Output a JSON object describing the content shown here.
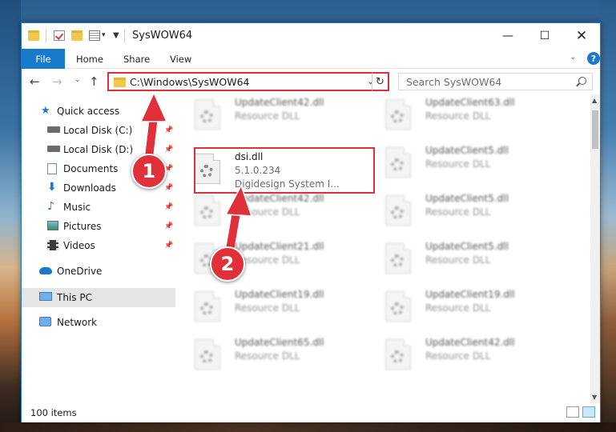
{
  "window": {
    "title": "SysWOW64"
  },
  "ribbon": {
    "tabs": [
      {
        "label": "File"
      },
      {
        "label": "Home"
      },
      {
        "label": "Share"
      },
      {
        "label": "View"
      }
    ],
    "help": "?"
  },
  "navbar": {
    "address_path": "C:\\Windows\\SysWOW64",
    "search_placeholder": "Search SysWOW64"
  },
  "sidebar": {
    "items": [
      {
        "label": "Quick access"
      },
      {
        "label": "Local Disk (C:)"
      },
      {
        "label": "Local Disk (D:)"
      },
      {
        "label": "Documents"
      },
      {
        "label": "Downloads"
      },
      {
        "label": "Music"
      },
      {
        "label": "Pictures"
      },
      {
        "label": "Videos"
      },
      {
        "label": "OneDrive"
      },
      {
        "label": "This PC"
      },
      {
        "label": "Network"
      }
    ]
  },
  "files": {
    "col1": [
      {
        "name": "UpdateClient42.dll",
        "type": "Resource DLL"
      },
      {
        "name": "dsi.dll",
        "version": "5.1.0.234",
        "company": "Digidesign System I..."
      },
      {
        "name": "UpdateClient42.dll",
        "type": "Resource DLL"
      },
      {
        "name": "UpdateClient21.dll",
        "type": "Resource DLL"
      },
      {
        "name": "UpdateClient19.dll",
        "type": "Resource DLL"
      },
      {
        "name": "UpdateClient65.dll",
        "type": "Resource DLL"
      }
    ],
    "col2": [
      {
        "name": "UpdateClient63.dll",
        "type": "Resource DLL"
      },
      {
        "name": "UpdateClient5.dll",
        "type": "Resource DLL"
      },
      {
        "name": "UpdateClient5.dll",
        "type": "Resource DLL"
      },
      {
        "name": "UpdateClient5.dll",
        "type": "Resource DLL"
      },
      {
        "name": "UpdateClient19.dll",
        "type": "Resource DLL"
      },
      {
        "name": "UpdateClient42.dll",
        "type": "Resource DLL"
      }
    ]
  },
  "status": {
    "item_count": "100 items"
  },
  "annotations": {
    "marker1": "1",
    "marker2": "2",
    "color": "#e0303a"
  }
}
